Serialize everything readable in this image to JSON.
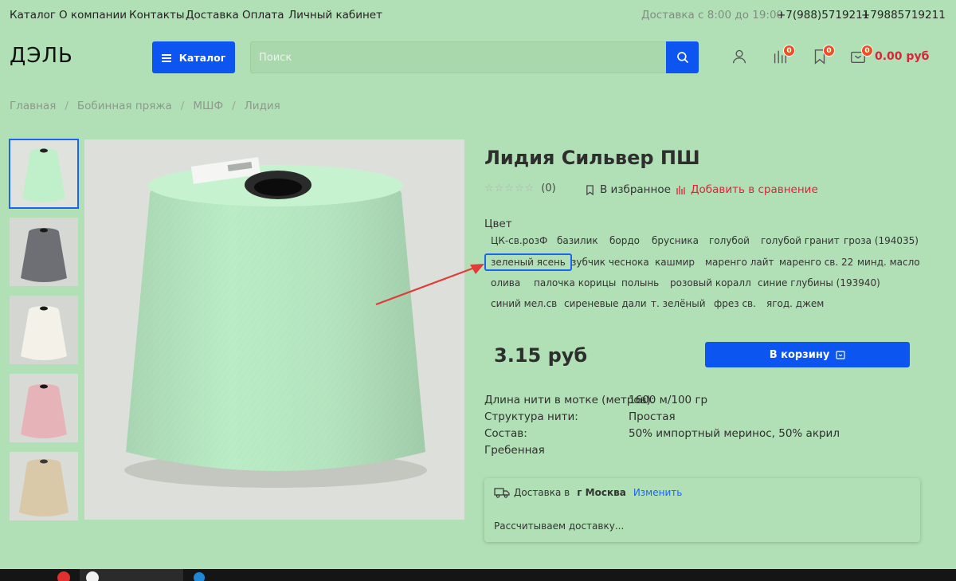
{
  "topbar": {
    "nav": [
      "Каталог",
      "О компании",
      "Контакты",
      "Доставка",
      "Оплата",
      "Личный кабинет"
    ],
    "hours": "Доставка с 8:00 до 19:00",
    "phone1": "+7(988)5719211",
    "phone2": "+79885719211"
  },
  "header": {
    "logo": "ДЭЛЬ",
    "catalog_label": "Каталог",
    "search_placeholder": "Поиск",
    "compare_count": "0",
    "favorites_count": "0",
    "cart_count": "0",
    "cart_total": "0.00 руб"
  },
  "breadcrumb": [
    "Главная",
    "Бобинная пряжа",
    "МШФ",
    "Лидия"
  ],
  "gallery": {
    "thumb_colors": [
      "#bff0c9",
      "#6e6f74",
      "#f3f1e8",
      "#e6b3b8",
      "#d9c9a8"
    ],
    "main_color": "#b9ecc4"
  },
  "product": {
    "title": "Лидия Сильвер ПШ",
    "stars": "☆☆☆☆☆",
    "rating_count": "(0)",
    "favorite_label": "В избранное",
    "compare_label": "Добавить в сравнение",
    "color_label": "Цвет",
    "colors": [
      "ЦК-св.розФ",
      "базилик",
      "бордо",
      "брусника",
      "голубой",
      "голубой гранит",
      "гроза (194035)",
      "зеленый ясень",
      "зубчик чеснока",
      "кашмир",
      "маренго лайт",
      "маренго св. 22",
      "минд. масло",
      "олива",
      "палочка корицы",
      "полынь",
      "розовый коралл",
      "синие глубины (193940)",
      "синий мел.св",
      "сиреневые дали",
      "т. зелёный",
      "фрез св.",
      "ягод. джем"
    ],
    "selected_color": "зеленый ясень",
    "price": "3.15 руб",
    "cart_button": "В корзину",
    "properties": [
      {
        "name": "Длина нити в мотке (метров):",
        "value": "1600 м/100 гр"
      },
      {
        "name": "Структура нити:",
        "value": "Простая"
      },
      {
        "name": "Состав:",
        "value": "50% импортный меринос, 50% акрил"
      },
      {
        "name": "Гребенная",
        "value": ""
      }
    ]
  },
  "delivery": {
    "label": "Доставка в",
    "city": "г Москва",
    "change": "Изменить",
    "status": "Рассчитываем доставку..."
  },
  "colors": {
    "page_bg": "#b2e0b6",
    "accent": "#0d55f0",
    "badge": "#f04e1e",
    "price_red": "#e0213a"
  }
}
